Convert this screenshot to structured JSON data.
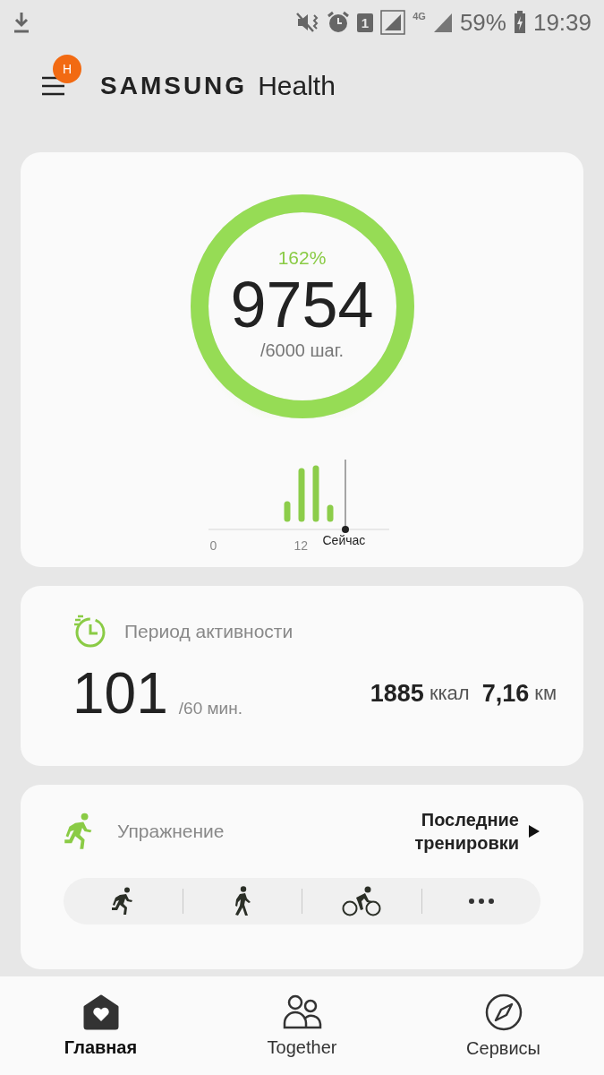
{
  "status_bar": {
    "battery": "59%",
    "time": "19:39",
    "sim_badge": "1",
    "network": "4G"
  },
  "header": {
    "badge": "H",
    "title_brand": "SAMSUNG",
    "title_app": "Health"
  },
  "steps": {
    "percent": "162%",
    "count": "9754",
    "goal": "/6000 шаг.",
    "level": 1,
    "axis_start": "0",
    "axis_mid": "12",
    "now_label": "Сейчас"
  },
  "activity": {
    "title": "Период активности",
    "minutes": "101",
    "goal": "/60 мин.",
    "calories_value": "1885",
    "calories_unit": "ккал",
    "distance_value": "7,16",
    "distance_unit": "км"
  },
  "exercise": {
    "title": "Упражнение",
    "link": "Последние тренировки",
    "types": [
      {
        "kind": "run"
      },
      {
        "kind": "walk"
      },
      {
        "kind": "bike"
      },
      {
        "kind": "more"
      }
    ]
  },
  "nav": [
    {
      "label": "Главная",
      "kind": "home",
      "selected": true
    },
    {
      "label": "Together",
      "kind": "together",
      "selected": false
    },
    {
      "label": "Сервисы",
      "kind": "compass",
      "selected": false
    }
  ]
}
